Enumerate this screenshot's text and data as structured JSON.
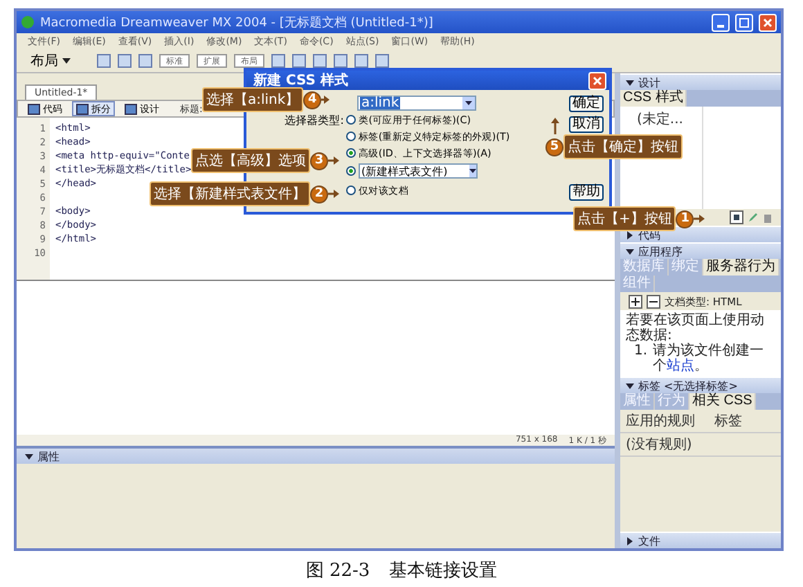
{
  "window": {
    "title": "Macromedia Dreamweaver MX 2004 - [无标题文档 (Untitled-1*)]",
    "menu": [
      "文件(F)",
      "编辑(E)",
      "查看(V)",
      "插入(I)",
      "修改(M)",
      "文本(T)",
      "命令(C)",
      "站点(S)",
      "窗口(W)",
      "帮助(H)"
    ]
  },
  "insert_bar": {
    "category": "布局",
    "modes": [
      "标准",
      "扩展",
      "布局"
    ]
  },
  "document": {
    "tab": "Untitled-1*",
    "views": [
      {
        "label": "代码",
        "selected": false
      },
      {
        "label": "拆分",
        "selected": true
      },
      {
        "label": "设计",
        "selected": false
      }
    ],
    "title_label": "标题:",
    "code_lines": [
      {
        "number": "1",
        "text": "<html>"
      },
      {
        "number": "2",
        "text": "<head>"
      },
      {
        "number": "3",
        "text": "<meta http-equiv=\"Conte"
      },
      {
        "number": "4",
        "text": "<title>无标题文档</title>"
      },
      {
        "number": "5",
        "text": "</head>"
      },
      {
        "number": "6"
      },
      {
        "number": "7",
        "text": "<body>"
      },
      {
        "number": "8",
        "text": "</body>"
      },
      {
        "number": "9",
        "text": "</html>"
      },
      {
        "number": "10"
      }
    ],
    "dimensions": "751 x 168",
    "size": "1 K / 1 秒"
  },
  "properties": {
    "title": "属性",
    "expanded": true
  },
  "panels": {
    "design": {
      "title": "设计",
      "expanded": true,
      "tab": "CSS 样式",
      "item": "(未定..."
    },
    "code": {
      "title": "代码",
      "expanded": false
    },
    "application": {
      "title": "应用程序",
      "expanded": true,
      "tabs": [
        {
          "label": "数据库",
          "selected": false
        },
        {
          "label": "绑定",
          "selected": false
        },
        {
          "label": "服务器行为",
          "selected": true
        },
        {
          "label": "组件",
          "selected": false
        }
      ],
      "doc_type": "文档类型: HTML",
      "message": "若要在该页面上使用动态数据:",
      "step_number": "1.",
      "step_text": "请为该文件创建一个",
      "step_link": "站点",
      "step_end": "。"
    },
    "tag": {
      "title": "标签 <无选择标签>",
      "expanded": true,
      "tabs": [
        {
          "label": "属性",
          "selected": false
        },
        {
          "label": "行为",
          "selected": false
        },
        {
          "label": "相关 CSS",
          "selected": true
        }
      ],
      "columns": [
        "应用的规则",
        "标签"
      ],
      "row": "(没有规则)"
    },
    "files": {
      "title": "文件",
      "expanded": false
    }
  },
  "dialog": {
    "title": "新建 CSS 样式",
    "name_value": "a:link",
    "selector_label": "选择器类型:",
    "selector_types": [
      {
        "label": "类(可应用于任何标签)(C)",
        "selected": false
      },
      {
        "label": "标签(重新定义特定标签的外观)(T)",
        "selected": false
      },
      {
        "label": "高级(ID、上下文选择器等)(A)",
        "selected": true
      }
    ],
    "define_in": [
      {
        "label": "(新建样式表文件)",
        "kind": "dropdown",
        "selected": true
      },
      {
        "label": "仅对该文档",
        "kind": "plain",
        "selected": false
      }
    ],
    "buttons": [
      "确定",
      "取消",
      "帮助"
    ]
  },
  "callouts": [
    {
      "number": "4",
      "text": "选择【a:link】"
    },
    {
      "number": "5",
      "text": "点击【确定】按钮"
    },
    {
      "number": "3",
      "text": "点选【高级】选项"
    },
    {
      "number": "2",
      "text": "选择【新建样式表文件】"
    },
    {
      "number": "1",
      "text": "点击【+】按钮"
    }
  ],
  "caption": {
    "label": "图 22-3",
    "text": "基本链接设置"
  }
}
